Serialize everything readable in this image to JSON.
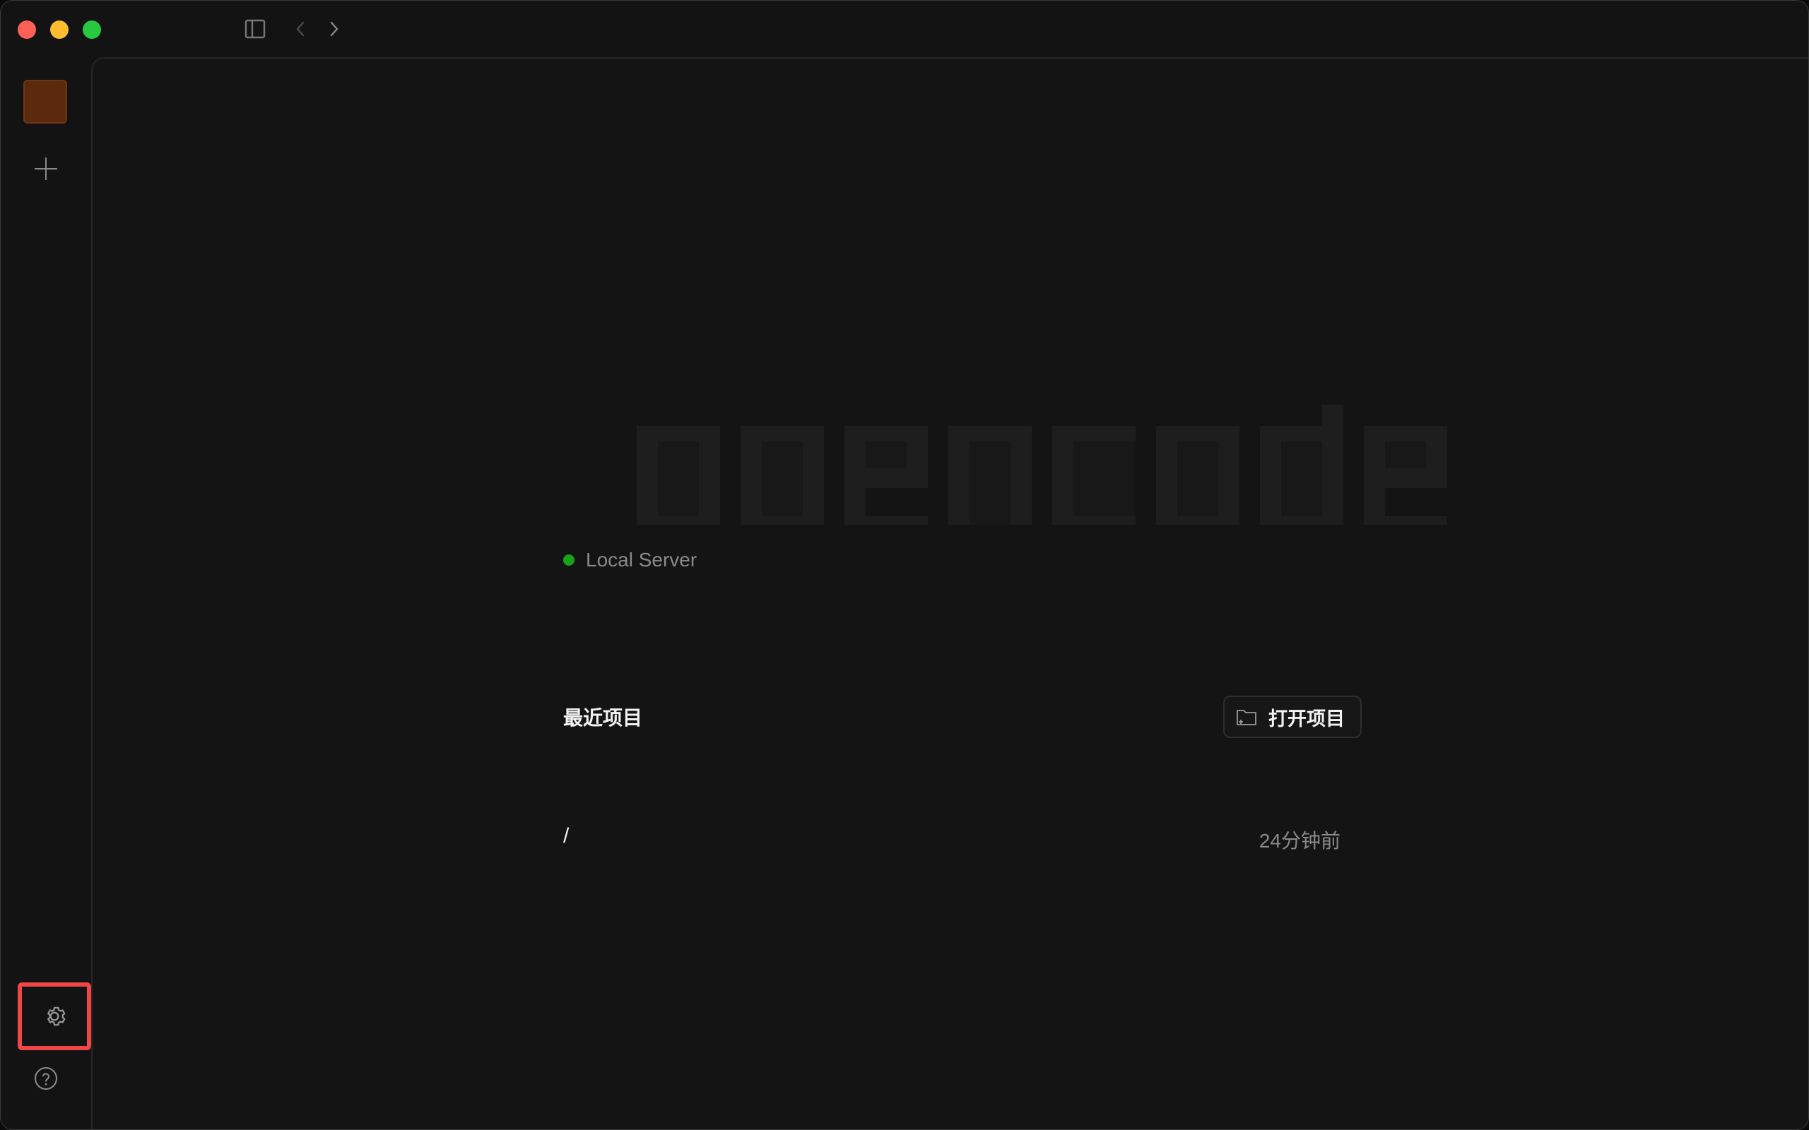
{
  "server": {
    "label": "Local Server",
    "status_color": "#16a316"
  },
  "recent": {
    "title": "最近项目",
    "open_button_label": "打开项目",
    "projects": [
      {
        "path": "/",
        "time": "24分钟前"
      }
    ]
  },
  "logo": {
    "text": "opencode"
  },
  "colors": {
    "background": "#131313",
    "avatar": "#5b2a0c",
    "highlight": "#f04646",
    "logo": "#1d1d1d"
  },
  "icons": {
    "sidebar_toggle": "sidebar-icon",
    "back": "chevron-left-icon",
    "forward": "chevron-right-icon",
    "add": "plus-icon",
    "settings": "gear-icon",
    "help": "question-icon",
    "folder": "folder-plus-icon"
  }
}
